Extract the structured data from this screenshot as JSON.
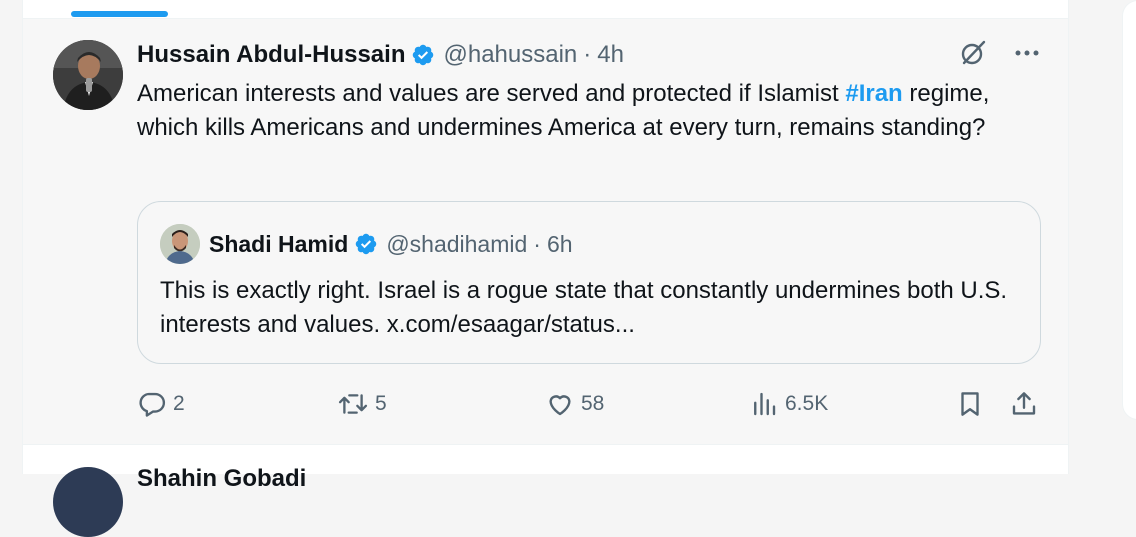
{
  "tweet": {
    "author_name": "Hussain Abdul-Hussain",
    "handle": "@hahussain",
    "separator": "·",
    "time": "4h",
    "text_before": "American interests and values are served and protected if Islamist ",
    "hashtag": "#Iran",
    "text_after": " regime, which kills Americans and undermines America at every turn, remains standing?",
    "quote": {
      "author_name": "Shadi Hamid",
      "handle": "@shadihamid",
      "separator": "·",
      "time": "6h",
      "text": "This is exactly right. Israel is a rogue state that constantly undermines both U.S. interests and values. x.com/esaagar/status..."
    },
    "stats": {
      "replies": "2",
      "reposts": "5",
      "likes": "58",
      "views": "6.5K"
    }
  },
  "next_tweet": {
    "author_name": "Shahin Gobadi"
  },
  "colors": {
    "accent": "#1d9bf0",
    "text": "#0f1419",
    "muted": "#536471",
    "border": "#cfd9de"
  },
  "icons": [
    "verified-badge-icon",
    "grok-icon",
    "more-icon",
    "reply-icon",
    "repost-icon",
    "like-icon",
    "views-icon",
    "bookmark-icon",
    "share-icon"
  ]
}
